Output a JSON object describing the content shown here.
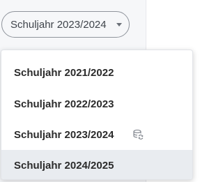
{
  "year_select": {
    "label": "Schuljahr 2023/2024",
    "caret_icon": "caret-down-icon"
  },
  "menu": {
    "items": [
      {
        "label": "Schuljahr 2021/2022"
      },
      {
        "label": "Schuljahr 2022/2023"
      },
      {
        "label": "Schuljahr 2023/2024",
        "icon": "database-sync-icon"
      },
      {
        "label": "Schuljahr 2024/2025",
        "highlighted": true
      }
    ]
  },
  "colors": {
    "panel_background": "#f6f7f9",
    "select_border": "#8f949c",
    "highlight": "#e9ecf0",
    "text": "#2b2b2b",
    "icon": "#7a7f87"
  }
}
